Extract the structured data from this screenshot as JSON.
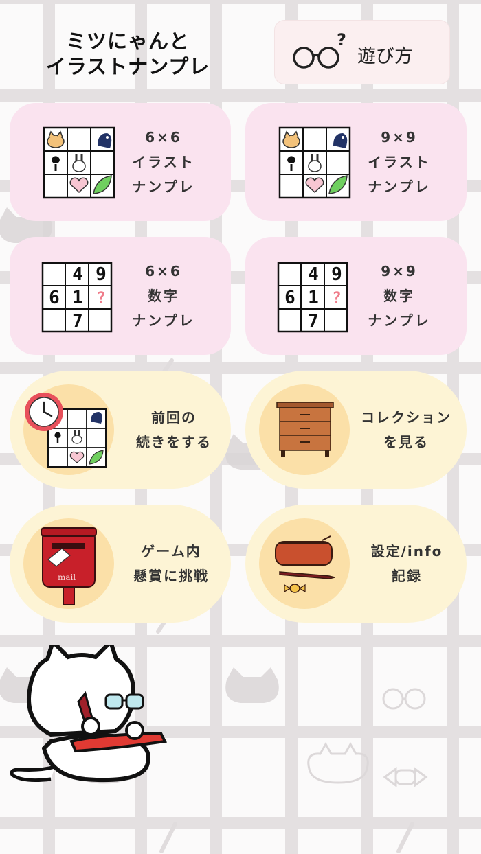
{
  "app": {
    "title_line1": "ミツにゃんと",
    "title_line2": "イラストナンプレ"
  },
  "howto": {
    "label": "遊び方",
    "icon": "glasses-question-icon"
  },
  "puzzles": [
    {
      "line1": "6×6",
      "line2": "イラスト",
      "line3": "ナンプレ"
    },
    {
      "line1": "9×9",
      "line2": "イラスト",
      "line3": "ナンプレ"
    },
    {
      "line1": "6×6",
      "line2": "数字",
      "line3": "ナンプレ"
    },
    {
      "line1": "9×9",
      "line2": "数字",
      "line3": "ナンプレ"
    }
  ],
  "digit_grid": [
    "",
    "4",
    "9",
    "6",
    "1",
    "?",
    "",
    "7",
    ""
  ],
  "actions": [
    {
      "line1": "前回の",
      "line2": "続きをする",
      "icon": "clock-puzzle-icon"
    },
    {
      "line1": "コレクション",
      "line2": "を見る",
      "icon": "drawer-chest-icon"
    },
    {
      "line1": "ゲーム内",
      "line2": "懸賞に挑戦",
      "icon": "mailbox-icon"
    },
    {
      "line1": "設定/info",
      "line2": "記録",
      "icon": "pencil-case-icon"
    }
  ],
  "mailbox_text": "mail",
  "colors": {
    "pink_card": "#fae3ef",
    "cream_card": "#fdf4d5",
    "circle": "#fbe0a8",
    "background_grid": "#e5e1e2"
  }
}
